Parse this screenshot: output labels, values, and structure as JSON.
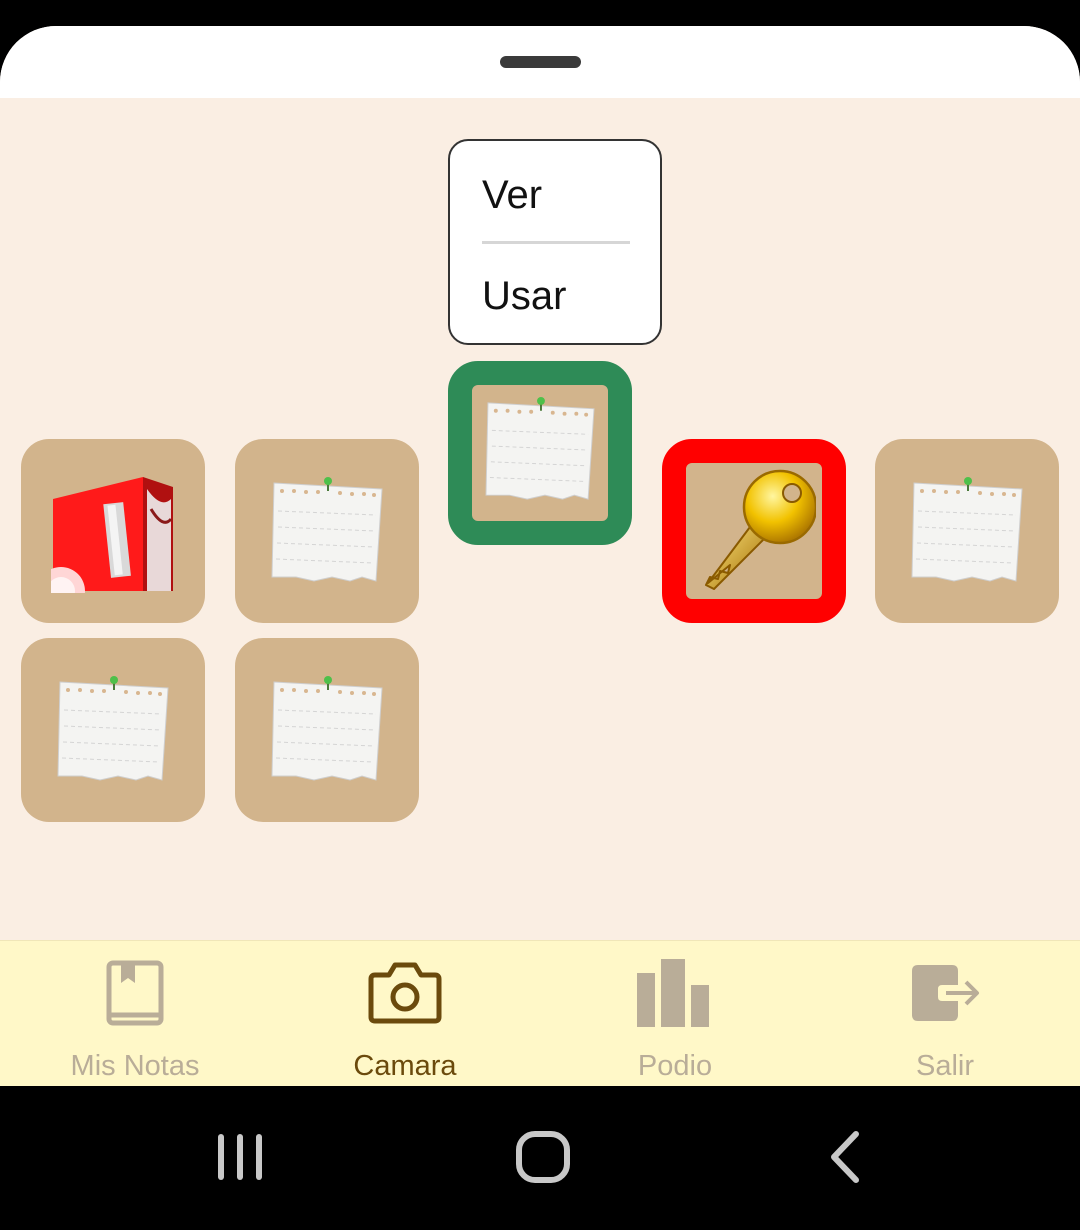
{
  "context_menu": {
    "items": [
      {
        "label": "Ver"
      },
      {
        "label": "Usar"
      }
    ]
  },
  "grid": {
    "tiles": [
      {
        "icon": "red-book-icon",
        "state": "normal"
      },
      {
        "icon": "note-paper-icon",
        "state": "normal"
      },
      {
        "icon": "note-paper-icon",
        "state": "selected"
      },
      {
        "icon": "golden-key-icon",
        "state": "highlighted"
      },
      {
        "icon": "note-paper-icon",
        "state": "normal"
      },
      {
        "icon": "note-paper-icon",
        "state": "normal"
      },
      {
        "icon": "note-paper-icon",
        "state": "normal"
      }
    ],
    "colors": {
      "tile": "#d2b48c",
      "selected_border": "#2e8b57",
      "highlight_border": "#ff0000",
      "background": "#faeee3"
    }
  },
  "bottom_nav": {
    "items": [
      {
        "label": "Mis Notas",
        "icon": "book-bookmark-icon",
        "active": false
      },
      {
        "label": "Camara",
        "icon": "camera-icon",
        "active": true
      },
      {
        "label": "Podio",
        "icon": "bar-chart-icon",
        "active": false
      },
      {
        "label": "Salir",
        "icon": "logout-icon",
        "active": false
      }
    ],
    "colors": {
      "active": "#6b4a0c",
      "inactive": "#b9ad98",
      "background": "#fff8c8"
    }
  },
  "system_nav": {
    "buttons": [
      {
        "icon": "recent-apps-icon"
      },
      {
        "icon": "home-icon"
      },
      {
        "icon": "back-icon"
      }
    ]
  }
}
